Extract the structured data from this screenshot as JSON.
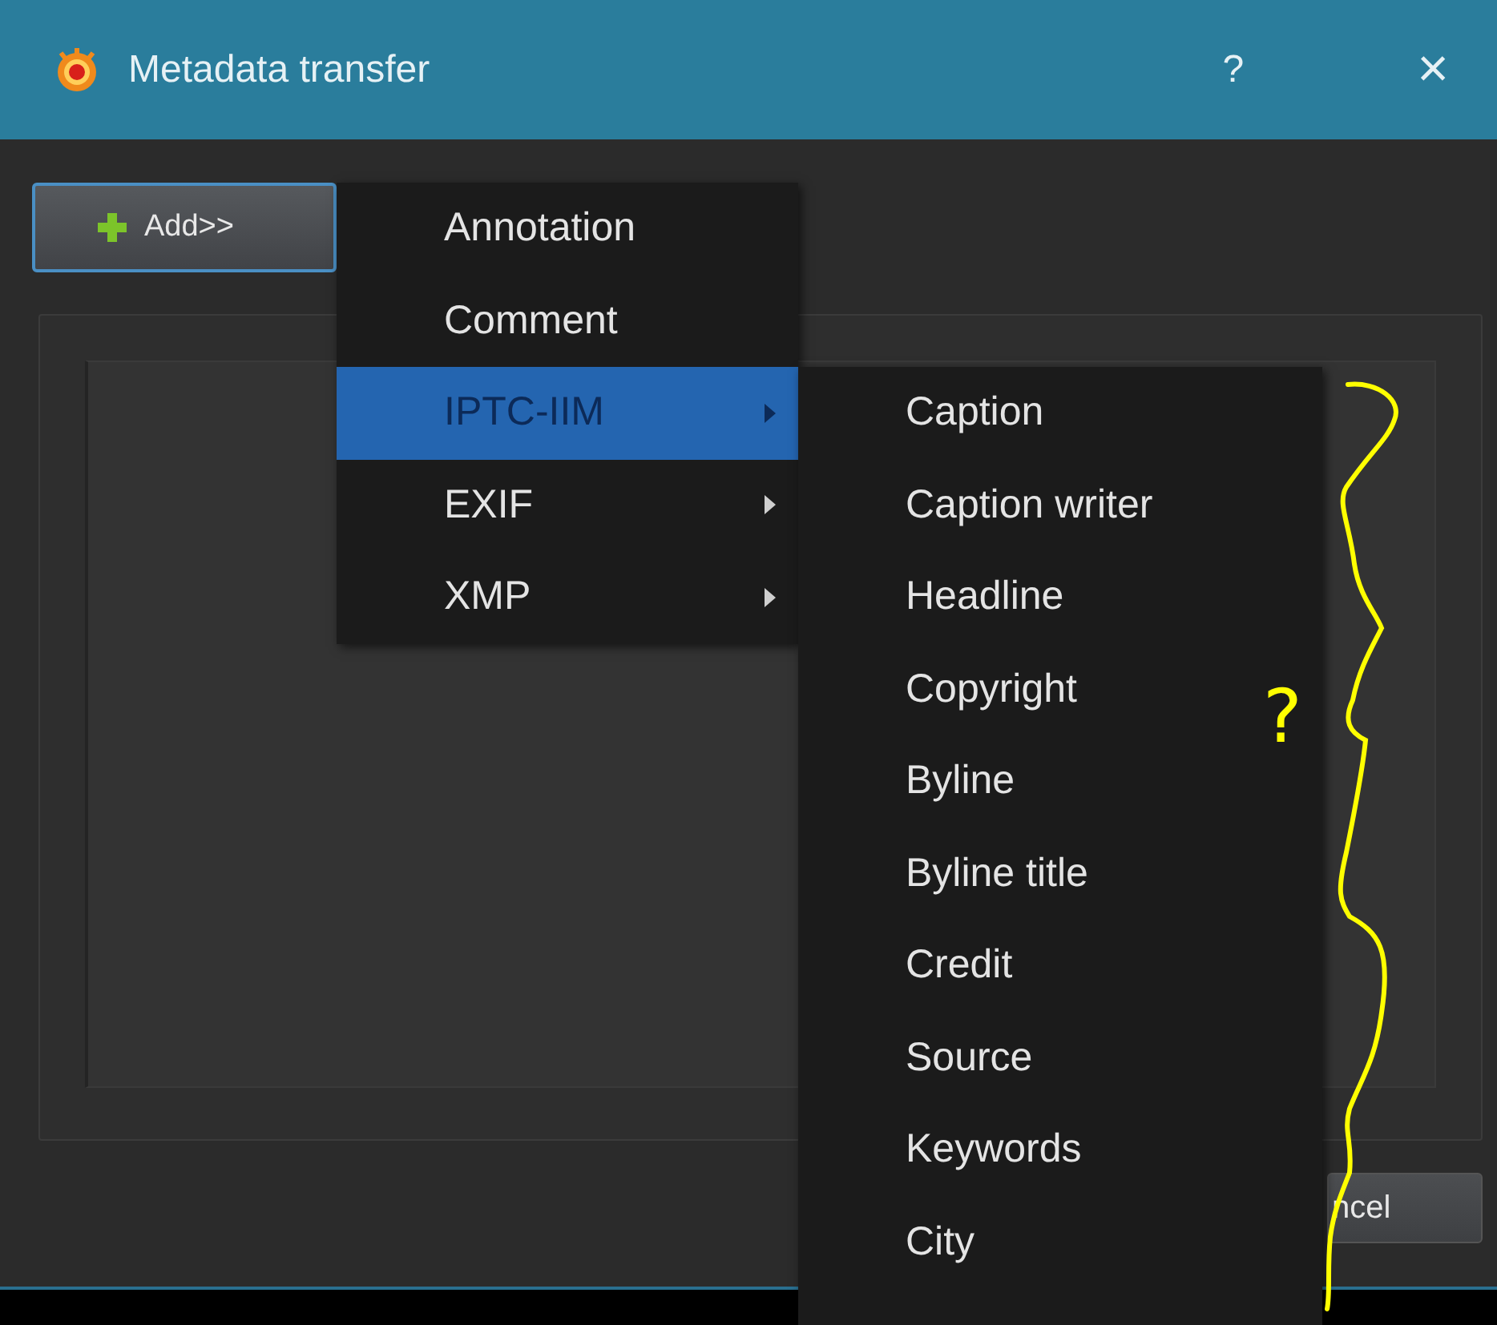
{
  "window": {
    "title": "Metadata transfer",
    "help": "?",
    "close": "×"
  },
  "add_button": {
    "label": "Add>>"
  },
  "menu": {
    "items": [
      {
        "label": "Annotation",
        "selected": false,
        "has_submenu": false
      },
      {
        "label": "Comment",
        "selected": false,
        "has_submenu": false
      },
      {
        "label": "IPTC-IIM",
        "selected": true,
        "has_submenu": true
      },
      {
        "label": "EXIF",
        "selected": false,
        "has_submenu": true
      },
      {
        "label": "XMP",
        "selected": false,
        "has_submenu": true
      }
    ]
  },
  "submenu": {
    "items": [
      {
        "label": "Caption"
      },
      {
        "label": "Caption writer"
      },
      {
        "label": "Headline"
      },
      {
        "label": "Copyright"
      },
      {
        "label": "Byline"
      },
      {
        "label": "Byline title"
      },
      {
        "label": "Credit"
      },
      {
        "label": "Source"
      },
      {
        "label": "Keywords"
      },
      {
        "label": "City"
      }
    ]
  },
  "cancel_button": {
    "label": "ncel"
  },
  "annotation": {
    "mark": "?"
  }
}
